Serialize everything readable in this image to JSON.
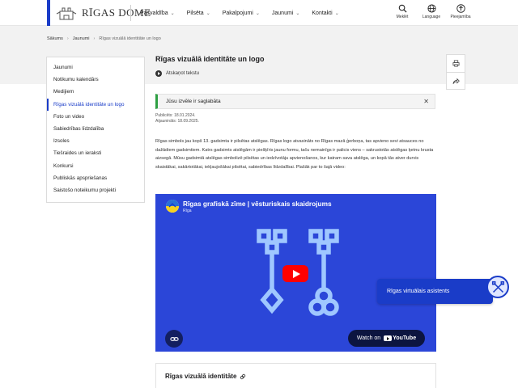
{
  "header": {
    "logo_text": "RĪGAS DOME",
    "nav": [
      {
        "label": "Pašvaldība"
      },
      {
        "label": "Pilsēta"
      },
      {
        "label": "Pakalpojumi"
      },
      {
        "label": "Jaunumi"
      },
      {
        "label": "Kontakti"
      }
    ],
    "tools": [
      {
        "label": "Meklēt",
        "icon": "search-icon"
      },
      {
        "label": "Language",
        "icon": "globe-icon"
      },
      {
        "label": "Pieejamība",
        "icon": "accessibility-icon"
      }
    ]
  },
  "breadcrumb": {
    "items": [
      "Sākums",
      "Jaunumi",
      "Rīgas vizuālā identitāte un logo"
    ]
  },
  "sidebar": {
    "items": [
      {
        "label": "Jaunumi"
      },
      {
        "label": "Notikumu kalendārs"
      },
      {
        "label": "Medijiem"
      },
      {
        "label": "Rīgas vizuālā identitāte un logo",
        "active": true
      },
      {
        "label": "Foto un video"
      },
      {
        "label": "Sabiedrības līdzdalība"
      },
      {
        "label": "Izsoles"
      },
      {
        "label": "Tiešraides un ieraksti"
      },
      {
        "label": "Konkursi"
      },
      {
        "label": "Publiskās apspriešanas"
      },
      {
        "label": "Saistošo noteikumu projekti"
      }
    ]
  },
  "main": {
    "title": "Rīgas vizuālā identitāte un logo",
    "listen_label": "Atskaņot tekstu",
    "alert_text": "Jūsu izvēle ir saglabāta",
    "published": "Publicēts: 18.01.2024.",
    "updated": "Atjaunināts: 18.09.2025.",
    "body": "Rīgas simbols jau kopš 13. gadsimta ir pilsētas atslēgas. Rīgas logo atvasināts no Rīgas mazā ģerboņa, tas apvieno sevi atsauces no dažādiem gadsimtiem. Katrs gadsimts atslēgām ir piešķīris jaunu formu, taču nemainīgs ir palicis viens – sakrustotās atslēgas ķetnu krusta aizsegā. Mūsu gadsimtā atslēgas simbolizē pilsētas un iedzīvotāju apvienošanos, kur katram sava atslēga, un kopā tās atver durvis skaistākai, sakārtotākai, iekļaujošākai pilsētai, sabiedrības līdzdalībai. Plašāk par to šajā video:"
  },
  "video": {
    "title": "Rīgas grafiskā zīme | vēsturiskais skaidrojums",
    "channel": "Rīga",
    "watch_label": "Watch on",
    "youtube_label": "YouTube"
  },
  "assistant": {
    "label": "Rīgas virtuālais asistents"
  },
  "section": {
    "title": "Rīgas vizuālā identitāte"
  },
  "colors": {
    "brand_blue": "#1a3cc8",
    "video_bg": "#2b46d8",
    "key_color": "#9fc7ff",
    "alert_green": "#2ea043"
  }
}
